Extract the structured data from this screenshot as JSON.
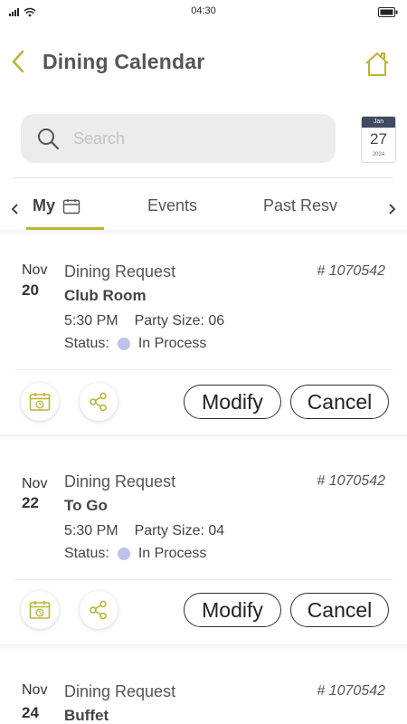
{
  "status_bar": {
    "time": "04:30"
  },
  "header": {
    "title": "Dining Calendar"
  },
  "search": {
    "placeholder": "Search"
  },
  "calendar_widget": {
    "month": "Jan",
    "day": "27",
    "year": "2024"
  },
  "tabs": [
    {
      "label": "My"
    },
    {
      "label": "Events"
    },
    {
      "label": "Past Resv"
    }
  ],
  "colors": {
    "accent": "#bcb436",
    "status_dot": "#bcc2ee",
    "calendar_header": "#3f4b60"
  },
  "reservations": [
    {
      "month": "Nov",
      "day": "20",
      "title": "Dining Request",
      "number": "# 1070542",
      "venue": "Club Room",
      "time": "5:30 PM",
      "party": "Party Size: 06",
      "status_label": "Status:",
      "status": "In Process",
      "modify": "Modify",
      "cancel": "Cancel"
    },
    {
      "month": "Nov",
      "day": "22",
      "title": "Dining Request",
      "number": "# 1070542",
      "venue": "To Go",
      "time": "5:30 PM",
      "party": "Party Size: 04",
      "status_label": "Status:",
      "status": "In Process",
      "modify": "Modify",
      "cancel": "Cancel"
    },
    {
      "month": "Nov",
      "day": "24",
      "title": "Dining Request",
      "number": "# 1070542",
      "venue": "Buffet"
    }
  ]
}
